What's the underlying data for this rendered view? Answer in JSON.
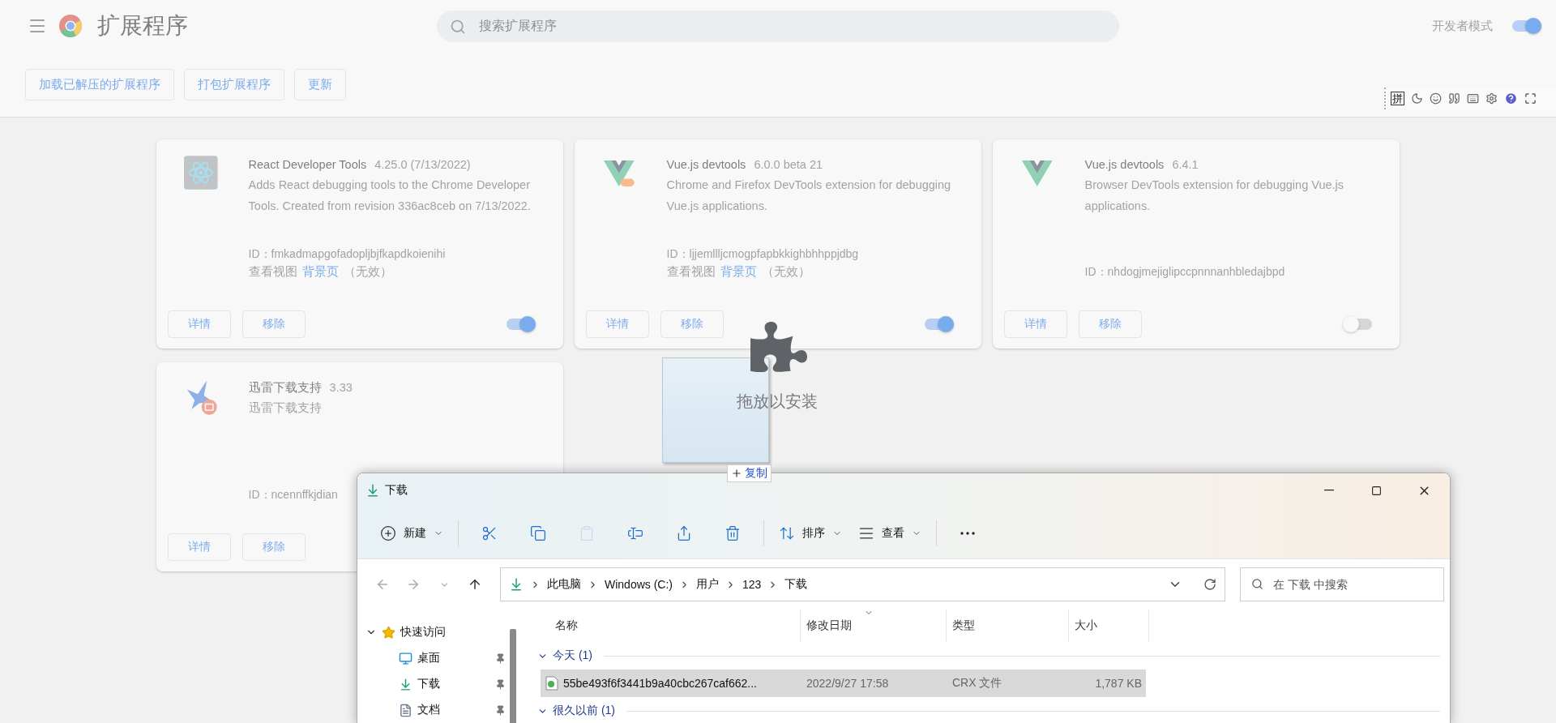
{
  "header": {
    "title": "扩展程序",
    "search": {
      "placeholder": "搜索扩展程序"
    },
    "dev_mode": {
      "label": "开发者模式",
      "on": true
    }
  },
  "toolbar": [
    "加载已解压的扩展程序",
    "打包扩展程序",
    "更新"
  ],
  "ime_toolbar": {
    "label": "拼"
  },
  "extensions": [
    {
      "kind": "react",
      "name": "React Developer Tools",
      "version": "4.25.0 (7/13/2022)",
      "description": "Adds React debugging tools to the Chrome Developer Tools. Created from revision 336ac8ceb on 7/13/2022.",
      "id": "ID：fmkadmapgofadopljbjfkapdkoienihi",
      "views_label": "查看视图",
      "view_link": "背景页",
      "view_note": "（无效）",
      "buttons": [
        "详情",
        "移除"
      ],
      "on": true
    },
    {
      "kind": "vue-beta",
      "name": "Vue.js devtools",
      "version": "6.0.0 beta 21",
      "description": "Chrome and Firefox DevTools extension for debugging Vue.js applications.",
      "id": "ID：ljjemllljcmogpfapbkkighbhhppjdbg",
      "views_label": "查看视图",
      "view_link": "背景页",
      "view_note": "（无效）",
      "buttons": [
        "详情",
        "移除"
      ],
      "on": true
    },
    {
      "kind": "vue",
      "name": "Vue.js devtools",
      "version": "6.4.1",
      "description": "Browser DevTools extension for debugging Vue.js applications.",
      "id": "ID：nhdogjmejiglipccpnnnanhbledajbpd",
      "buttons": [
        "详情",
        "移除"
      ],
      "on": false
    },
    {
      "kind": "thunder",
      "name": "迅雷下载支持",
      "version": "3.33",
      "description": "迅雷下载支持",
      "id": "ID：ncennffkjdian",
      "buttons": [
        "详情",
        "移除"
      ]
    }
  ],
  "drag": {
    "hint": "拖放以安装",
    "action": "复制"
  },
  "explorer": {
    "title": "下载",
    "toolbar": [
      {
        "kind": "new",
        "label": "新建",
        "menu": true,
        "disabled": false
      },
      {
        "kind": "cut",
        "menu": false,
        "disabled": false
      },
      {
        "kind": "copy",
        "menu": false,
        "disabled": false
      },
      {
        "kind": "paste",
        "menu": false,
        "disabled": true
      },
      {
        "kind": "rename",
        "menu": false,
        "disabled": false
      },
      {
        "kind": "share",
        "menu": false,
        "disabled": false
      },
      {
        "kind": "delete",
        "menu": false,
        "disabled": false
      },
      {
        "kind": "sort",
        "label": "排序",
        "menu": true,
        "disabled": false
      },
      {
        "kind": "view",
        "label": "查看",
        "menu": true,
        "disabled": false
      },
      {
        "kind": "more",
        "menu": false,
        "disabled": false
      }
    ],
    "nav": [
      {
        "kind": "back",
        "disabled": true
      },
      {
        "kind": "forward",
        "disabled": true
      },
      {
        "kind": "recent",
        "disabled": true
      },
      {
        "kind": "up",
        "disabled": false
      }
    ],
    "breadcrumb": [
      "此电脑",
      "Windows (C:)",
      "用户",
      "123",
      "下载"
    ],
    "search": {
      "placeholder": "在 下载 中搜索"
    },
    "sidebar": [
      {
        "kind": "quick",
        "label": "快速访问",
        "expanded": true,
        "children": [
          {
            "kind": "desktop",
            "label": "桌面",
            "pinned": true
          },
          {
            "kind": "downloads",
            "label": "下载",
            "pinned": true
          },
          {
            "kind": "documents",
            "label": "文档",
            "pinned": true
          }
        ]
      }
    ],
    "columns": [
      {
        "label": "名称",
        "sorted": false
      },
      {
        "label": "修改日期",
        "sorted": true
      },
      {
        "label": "类型",
        "sorted": false
      },
      {
        "label": "大小",
        "sorted": false
      }
    ],
    "groups": [
      {
        "label": "今天 (1)",
        "expanded": true,
        "rows": [
          {
            "name": "55be493f6f3441b9a40cbc267caf662...",
            "date": "2022/9/27 17:58",
            "type": "CRX 文件",
            "size": "1,787 KB",
            "selected": true
          }
        ]
      },
      {
        "label": "很久以前 (1)",
        "expanded": true
      }
    ]
  }
}
